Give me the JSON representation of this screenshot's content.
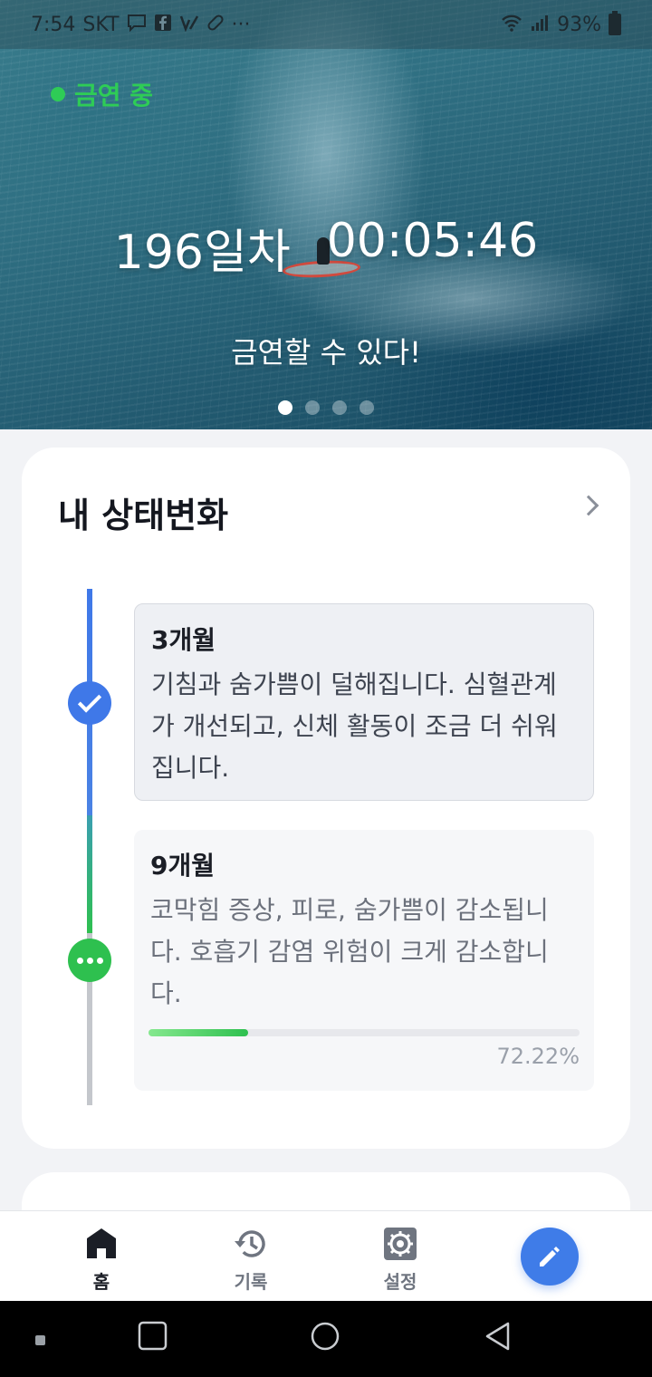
{
  "statusbar": {
    "time": "7:54",
    "carrier": "SKT",
    "battery": "93%",
    "more": "···"
  },
  "hero": {
    "status_label": "금연 중",
    "days": "196일차",
    "timer": "00:05:46",
    "motto": "금연할 수 있다!",
    "page_count": 4,
    "active_page": 1
  },
  "status_card": {
    "title": "내 상태변화",
    "milestones": [
      {
        "title": "3개월",
        "lines": [
          "기침과 숨가쁨이 덜해집니다. 심혈관계",
          "가 개선되고, 신체 활동이 조금 더 쉬워",
          "집니다."
        ],
        "state": "done"
      },
      {
        "title": "9개월",
        "lines": [
          "코막힘 증상, 피로, 숨가쁨이 감소됩니",
          "다. 호흡기 감염 위험이 크게 감소합니",
          "다."
        ],
        "state": "in-progress",
        "progress": 0.2311,
        "progress_label": "72.22%"
      }
    ]
  },
  "bottom_nav": {
    "items": [
      {
        "label": "홈",
        "icon": "home-icon",
        "active": true
      },
      {
        "label": "기록",
        "icon": "history-icon",
        "active": false
      },
      {
        "label": "설정",
        "icon": "settings-icon",
        "active": false
      }
    ],
    "fab_icon": "pencil-icon"
  },
  "colors": {
    "accent_blue": "#3f78e8",
    "accent_green": "#2ec04f",
    "status_green": "#2ecc56"
  }
}
